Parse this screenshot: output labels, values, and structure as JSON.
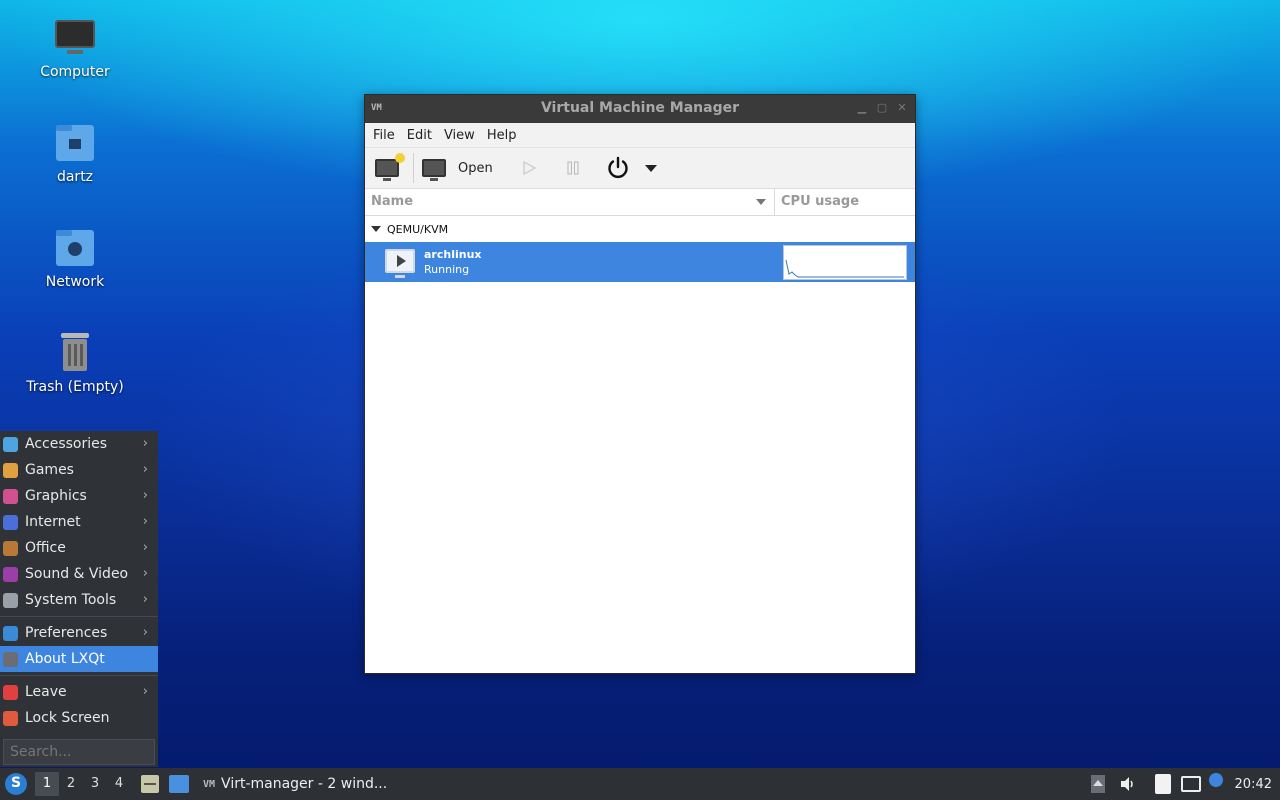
{
  "desktop": {
    "icons": [
      {
        "label": "Computer",
        "icon": "monitor-icon"
      },
      {
        "label": "dartz",
        "icon": "home-folder-icon"
      },
      {
        "label": "Network",
        "icon": "network-folder-icon"
      },
      {
        "label": "Trash (Empty)",
        "icon": "trash-icon"
      }
    ]
  },
  "window": {
    "title": "Virtual Machine Manager",
    "menu": [
      "File",
      "Edit",
      "View",
      "Help"
    ],
    "toolbar": {
      "open_label": "Open"
    },
    "columns": {
      "name": "Name",
      "cpu": "CPU usage"
    },
    "group": "QEMU/KVM",
    "vm": {
      "name": "archlinux",
      "status": "Running"
    }
  },
  "start_menu": {
    "items": [
      {
        "label": "Accessories",
        "color": "#4fa3e0",
        "submenu": true
      },
      {
        "label": "Games",
        "color": "#e0a040",
        "submenu": true
      },
      {
        "label": "Graphics",
        "color": "#d05090",
        "submenu": true
      },
      {
        "label": "Internet",
        "color": "#4a6fd8",
        "submenu": true
      },
      {
        "label": "Office",
        "color": "#b87838",
        "submenu": true
      },
      {
        "label": "Sound & Video",
        "color": "#9a3fa8",
        "submenu": true
      },
      {
        "label": "System Tools",
        "color": "#9aa0a8",
        "submenu": true
      }
    ],
    "items2": [
      {
        "label": "Preferences",
        "color": "#3a8ad8",
        "submenu": true
      },
      {
        "label": "About LXQt",
        "color": "#6a6e74",
        "submenu": false
      }
    ],
    "items3": [
      {
        "label": "Leave",
        "color": "#e04040",
        "submenu": true
      },
      {
        "label": "Lock Screen",
        "color": "#e05a40",
        "submenu": false
      }
    ],
    "search_placeholder": "Search..."
  },
  "taskbar": {
    "workspaces": [
      "1",
      "2",
      "3",
      "4"
    ],
    "task_label": "Virt-manager - 2 wind...",
    "clock": "20:42"
  }
}
